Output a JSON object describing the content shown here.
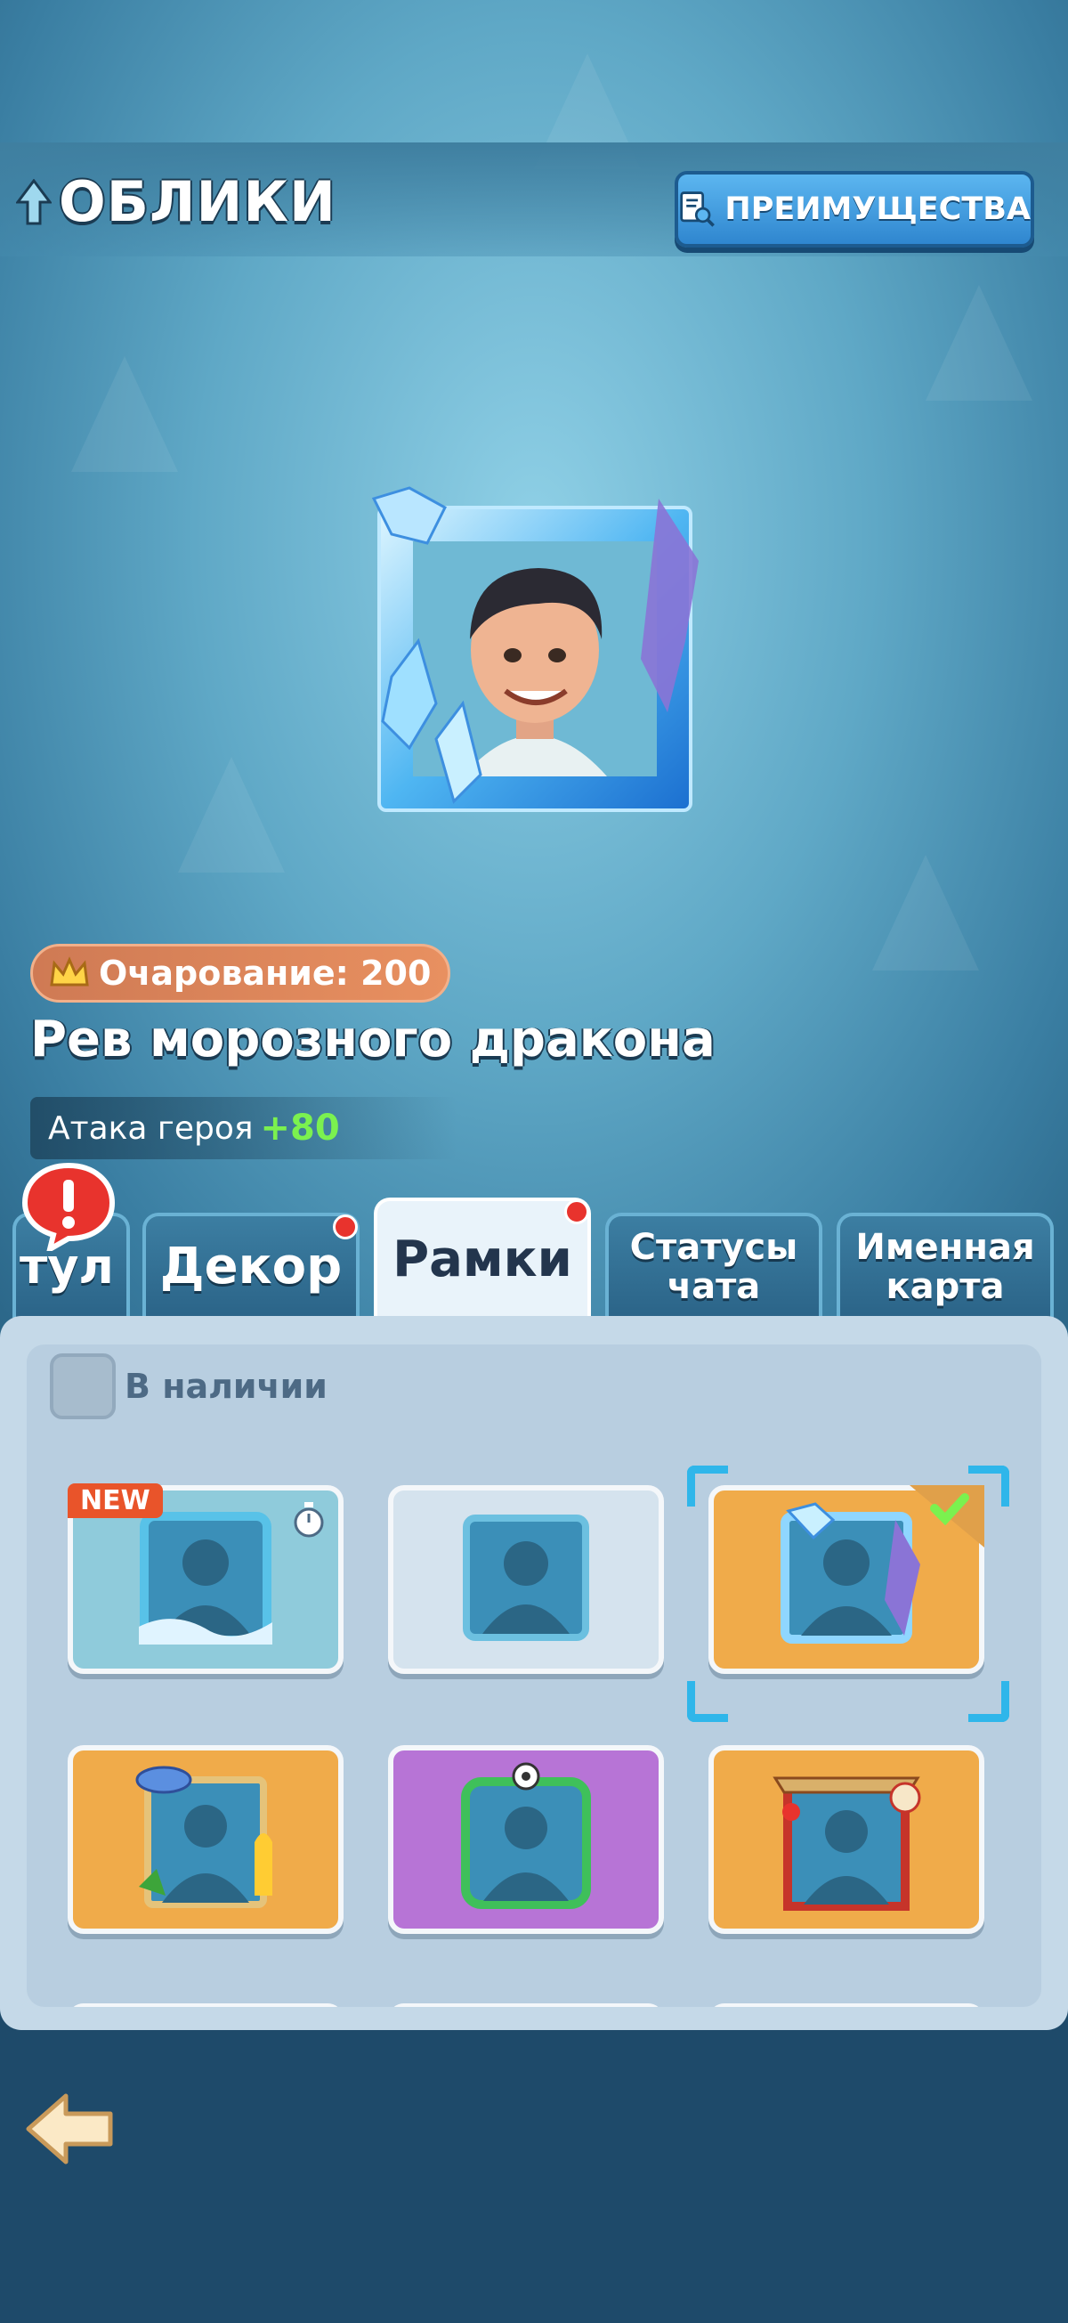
{
  "header": {
    "title": "ОБЛИКИ",
    "benefits_button": "ПРЕИМУЩЕСТВА"
  },
  "selected_skin": {
    "charm_label": "Очарование: 200",
    "name": "Рев морозного дракона",
    "attack_label": "Атака героя",
    "attack_value": "+80"
  },
  "tabs": [
    {
      "label": "тул",
      "active": false,
      "alert": true
    },
    {
      "label": "Декор",
      "active": false,
      "red_dot": true
    },
    {
      "label": "Рамки",
      "active": true,
      "red_dot": true
    },
    {
      "label": "Статусы чата",
      "active": false
    },
    {
      "label": "Именная карта",
      "active": false
    }
  ],
  "filter": {
    "label": "В наличии",
    "checked": false
  },
  "frames": [
    {
      "name": "ocean",
      "bg": "#8fcbdb",
      "badge": "NEW",
      "timer": true
    },
    {
      "name": "basic",
      "bg": "#d5e3ee"
    },
    {
      "name": "frost-dragon",
      "bg": "#f0ab4a",
      "selected": true,
      "owned": true
    },
    {
      "name": "ufo-palm",
      "bg": "#f0ab4a"
    },
    {
      "name": "football",
      "bg": "#b774d6"
    },
    {
      "name": "lion-dance",
      "bg": "#f0ab4a"
    }
  ]
}
